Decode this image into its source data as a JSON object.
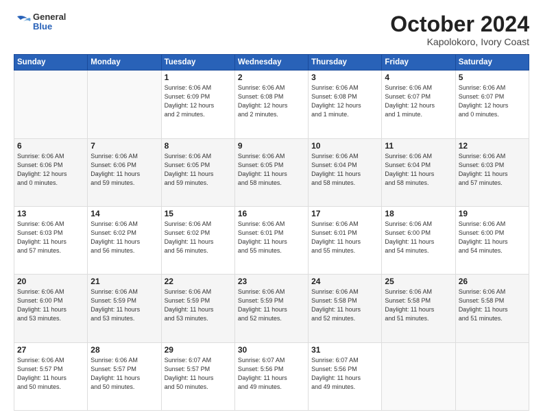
{
  "header": {
    "logo_general": "General",
    "logo_blue": "Blue",
    "month": "October 2024",
    "location": "Kapolokoro, Ivory Coast"
  },
  "days_of_week": [
    "Sunday",
    "Monday",
    "Tuesday",
    "Wednesday",
    "Thursday",
    "Friday",
    "Saturday"
  ],
  "weeks": [
    [
      {
        "day": "",
        "detail": ""
      },
      {
        "day": "",
        "detail": ""
      },
      {
        "day": "1",
        "detail": "Sunrise: 6:06 AM\nSunset: 6:09 PM\nDaylight: 12 hours\nand 2 minutes."
      },
      {
        "day": "2",
        "detail": "Sunrise: 6:06 AM\nSunset: 6:08 PM\nDaylight: 12 hours\nand 2 minutes."
      },
      {
        "day": "3",
        "detail": "Sunrise: 6:06 AM\nSunset: 6:08 PM\nDaylight: 12 hours\nand 1 minute."
      },
      {
        "day": "4",
        "detail": "Sunrise: 6:06 AM\nSunset: 6:07 PM\nDaylight: 12 hours\nand 1 minute."
      },
      {
        "day": "5",
        "detail": "Sunrise: 6:06 AM\nSunset: 6:07 PM\nDaylight: 12 hours\nand 0 minutes."
      }
    ],
    [
      {
        "day": "6",
        "detail": "Sunrise: 6:06 AM\nSunset: 6:06 PM\nDaylight: 12 hours\nand 0 minutes."
      },
      {
        "day": "7",
        "detail": "Sunrise: 6:06 AM\nSunset: 6:06 PM\nDaylight: 11 hours\nand 59 minutes."
      },
      {
        "day": "8",
        "detail": "Sunrise: 6:06 AM\nSunset: 6:05 PM\nDaylight: 11 hours\nand 59 minutes."
      },
      {
        "day": "9",
        "detail": "Sunrise: 6:06 AM\nSunset: 6:05 PM\nDaylight: 11 hours\nand 58 minutes."
      },
      {
        "day": "10",
        "detail": "Sunrise: 6:06 AM\nSunset: 6:04 PM\nDaylight: 11 hours\nand 58 minutes."
      },
      {
        "day": "11",
        "detail": "Sunrise: 6:06 AM\nSunset: 6:04 PM\nDaylight: 11 hours\nand 58 minutes."
      },
      {
        "day": "12",
        "detail": "Sunrise: 6:06 AM\nSunset: 6:03 PM\nDaylight: 11 hours\nand 57 minutes."
      }
    ],
    [
      {
        "day": "13",
        "detail": "Sunrise: 6:06 AM\nSunset: 6:03 PM\nDaylight: 11 hours\nand 57 minutes."
      },
      {
        "day": "14",
        "detail": "Sunrise: 6:06 AM\nSunset: 6:02 PM\nDaylight: 11 hours\nand 56 minutes."
      },
      {
        "day": "15",
        "detail": "Sunrise: 6:06 AM\nSunset: 6:02 PM\nDaylight: 11 hours\nand 56 minutes."
      },
      {
        "day": "16",
        "detail": "Sunrise: 6:06 AM\nSunset: 6:01 PM\nDaylight: 11 hours\nand 55 minutes."
      },
      {
        "day": "17",
        "detail": "Sunrise: 6:06 AM\nSunset: 6:01 PM\nDaylight: 11 hours\nand 55 minutes."
      },
      {
        "day": "18",
        "detail": "Sunrise: 6:06 AM\nSunset: 6:00 PM\nDaylight: 11 hours\nand 54 minutes."
      },
      {
        "day": "19",
        "detail": "Sunrise: 6:06 AM\nSunset: 6:00 PM\nDaylight: 11 hours\nand 54 minutes."
      }
    ],
    [
      {
        "day": "20",
        "detail": "Sunrise: 6:06 AM\nSunset: 6:00 PM\nDaylight: 11 hours\nand 53 minutes."
      },
      {
        "day": "21",
        "detail": "Sunrise: 6:06 AM\nSunset: 5:59 PM\nDaylight: 11 hours\nand 53 minutes."
      },
      {
        "day": "22",
        "detail": "Sunrise: 6:06 AM\nSunset: 5:59 PM\nDaylight: 11 hours\nand 53 minutes."
      },
      {
        "day": "23",
        "detail": "Sunrise: 6:06 AM\nSunset: 5:59 PM\nDaylight: 11 hours\nand 52 minutes."
      },
      {
        "day": "24",
        "detail": "Sunrise: 6:06 AM\nSunset: 5:58 PM\nDaylight: 11 hours\nand 52 minutes."
      },
      {
        "day": "25",
        "detail": "Sunrise: 6:06 AM\nSunset: 5:58 PM\nDaylight: 11 hours\nand 51 minutes."
      },
      {
        "day": "26",
        "detail": "Sunrise: 6:06 AM\nSunset: 5:58 PM\nDaylight: 11 hours\nand 51 minutes."
      }
    ],
    [
      {
        "day": "27",
        "detail": "Sunrise: 6:06 AM\nSunset: 5:57 PM\nDaylight: 11 hours\nand 50 minutes."
      },
      {
        "day": "28",
        "detail": "Sunrise: 6:06 AM\nSunset: 5:57 PM\nDaylight: 11 hours\nand 50 minutes."
      },
      {
        "day": "29",
        "detail": "Sunrise: 6:07 AM\nSunset: 5:57 PM\nDaylight: 11 hours\nand 50 minutes."
      },
      {
        "day": "30",
        "detail": "Sunrise: 6:07 AM\nSunset: 5:56 PM\nDaylight: 11 hours\nand 49 minutes."
      },
      {
        "day": "31",
        "detail": "Sunrise: 6:07 AM\nSunset: 5:56 PM\nDaylight: 11 hours\nand 49 minutes."
      },
      {
        "day": "",
        "detail": ""
      },
      {
        "day": "",
        "detail": ""
      }
    ]
  ]
}
